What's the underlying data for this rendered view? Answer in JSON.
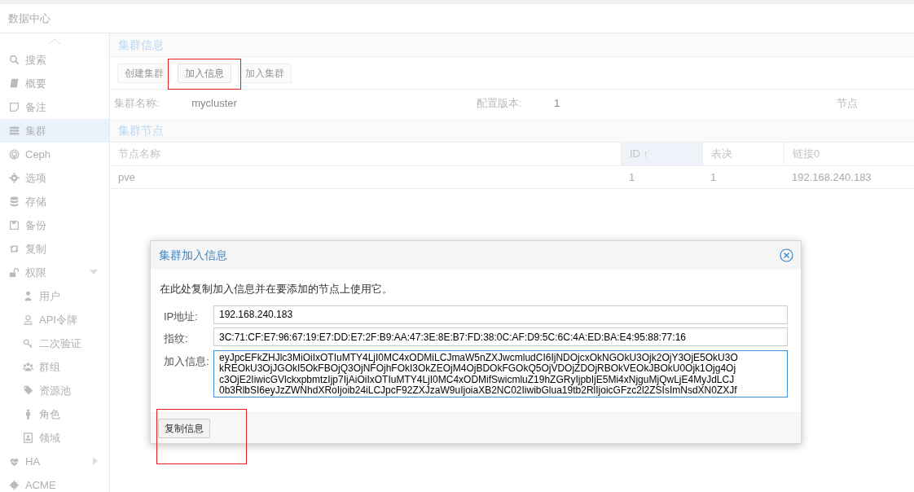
{
  "header": {
    "title": "数据中心"
  },
  "sidebar": {
    "items": [
      {
        "label": "搜索",
        "selected": false
      },
      {
        "label": "概要",
        "selected": false
      },
      {
        "label": "备注",
        "selected": false
      },
      {
        "label": "集群",
        "selected": true
      },
      {
        "label": "Ceph",
        "selected": false
      },
      {
        "label": "选项",
        "selected": false
      },
      {
        "label": "存储",
        "selected": false
      },
      {
        "label": "备份",
        "selected": false
      },
      {
        "label": "复制",
        "selected": false
      },
      {
        "label": "权限",
        "selected": false,
        "expanded": true,
        "children": [
          {
            "label": "用户",
            "selected": false
          },
          {
            "label": "API令牌",
            "selected": false
          },
          {
            "label": "二次验证",
            "selected": false
          },
          {
            "label": "群组",
            "selected": false
          },
          {
            "label": "资源池",
            "selected": false
          },
          {
            "label": "角色",
            "selected": false
          },
          {
            "label": "领域",
            "selected": false
          }
        ]
      },
      {
        "label": "HA",
        "selected": false,
        "expanded": false
      },
      {
        "label": "ACME",
        "selected": false
      }
    ]
  },
  "cluster_info": {
    "title": "集群信息",
    "toolbar": [
      {
        "label": "创建集群",
        "highlighted": false
      },
      {
        "label": "加入信息",
        "highlighted": true
      },
      {
        "label": "加入集群",
        "highlighted": false
      }
    ],
    "fields": [
      {
        "label": "集群名称:",
        "value": "mycluster"
      },
      {
        "label": "配置版本:",
        "value": "1"
      },
      {
        "label": "节点"
      }
    ]
  },
  "cluster_nodes": {
    "title": "集群节点",
    "table": {
      "columns": [
        {
          "label": "节点名称",
          "sorted": false
        },
        {
          "label": "ID ↑",
          "sorted": true
        },
        {
          "label": "表决",
          "sorted": false
        },
        {
          "label": "链接0",
          "sorted": false
        }
      ],
      "rows": [
        [
          "pve",
          "1",
          "1",
          "192.168.240.183"
        ]
      ]
    }
  },
  "dialog": {
    "title": "集群加入信息",
    "description": "在此处复制加入信息并在要添加的节点上使用它。",
    "fields": [
      {
        "kind": "text",
        "label": "IP地址:",
        "value": "192.168.240.183",
        "focused": false
      },
      {
        "kind": "text",
        "label": "指纹:",
        "value": "3C:71:CF:E7:96:67:19:E7:DD:E7:2F:B9:AA:47:3E:8E:B7:FD:38:0C:AF:D9:5C:6C:4A:ED:BA:E4:95:88:77:16",
        "focused": false
      },
      {
        "kind": "textarea",
        "label": "加入信息:",
        "focused": true,
        "value": "eyJpcEFkZHJlc3MiOiIxOTIuMTY4LjI0MC4xODMiLCJmaW5nZXJwcmludCI6IjNDOjcxOkNGOkU3Ojk2OjY3OjE5OkU3OkREOkU3OjJGOkI5OkFBOjQ3OjNFOjhFOkI3OkZEOjM4OjBDOkFGOkQ5OjVDOjZDOjRBOkVEOkJBOkU0Ojk1Ojg4Ojc3OjE2IiwicGVlckxpbmtzIjp7IjAiOiIxOTIuMTY4LjI0MC4xODMifSwicmluZ19hZGRyIjpbIjE5Mi4xNjguMjQwLjE4MyJdLCJ0b3RlbSI6eyJzZWNhdXRoIjoib24iLCJpcF92ZXJzaW9uIjoiaXB2NC02IiwibGlua19tb2RlIjoicGFzc2l2ZSIsImNsdXN0ZXJf"
      }
    ],
    "buttons": [
      {
        "label": "复制信息",
        "highlighted": true
      }
    ]
  }
}
